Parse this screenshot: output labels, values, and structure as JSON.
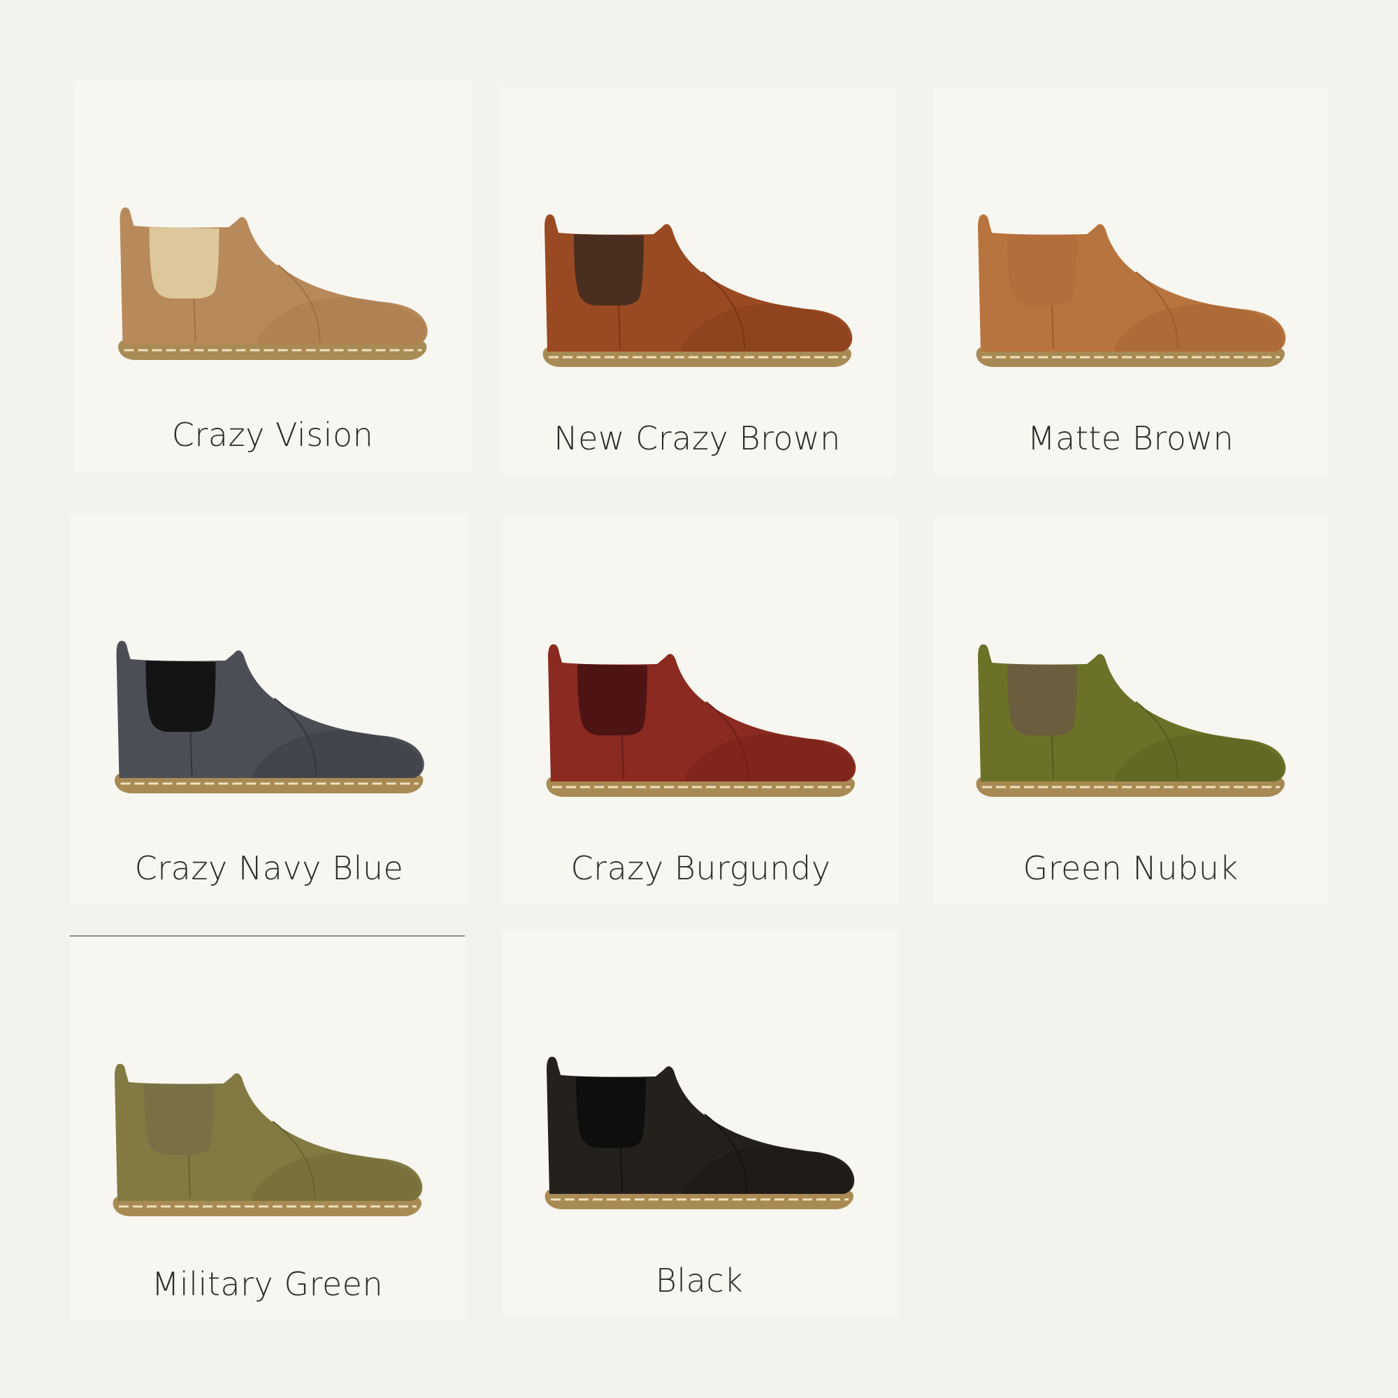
{
  "colors": {
    "page_background": "#f4f2ee",
    "card_background": "#f8f6f1",
    "label_text": "#2b2b2b",
    "sole": "#a88a54",
    "stitch": "#efe2c0"
  },
  "products": [
    {
      "name": "Crazy Vision",
      "image": "boot-icon",
      "leather": "#b8895a",
      "leather_dark": "#9d7247",
      "elastic": "#dcc89a"
    },
    {
      "name": "New Crazy Brown",
      "image": "boot-icon",
      "leather": "#9a4a22",
      "leather_dark": "#7a3616",
      "elastic": "#4a2e20"
    },
    {
      "name": "Matte Brown",
      "image": "boot-icon",
      "leather": "#b8743e",
      "leather_dark": "#9c5d2b",
      "elastic": "#b46e3c"
    },
    {
      "name": "Crazy Navy Blue",
      "image": "boot-icon",
      "leather": "#4b4e55",
      "leather_dark": "#34363c",
      "elastic": "#141414"
    },
    {
      "name": "Crazy Burgundy",
      "image": "boot-icon",
      "leather": "#8a2a20",
      "leather_dark": "#6c1e18",
      "elastic": "#4e1414"
    },
    {
      "name": "Green Nubuk",
      "image": "boot-icon",
      "leather": "#6b7228",
      "leather_dark": "#545a1c",
      "elastic": "#6a5e3e"
    },
    {
      "name": "Military Green",
      "image": "boot-icon",
      "leather": "#827a42",
      "leather_dark": "#6a6232",
      "elastic": "#7a7046"
    },
    {
      "name": "Black",
      "image": "boot-icon",
      "leather": "#24211d",
      "leather_dark": "#141210",
      "elastic": "#0e0e0e"
    }
  ]
}
